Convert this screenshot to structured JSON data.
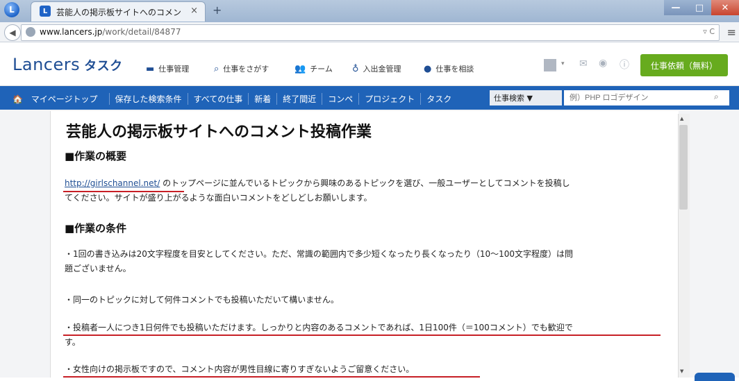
{
  "browser": {
    "app_letter": "L",
    "tab": {
      "favicon": "L",
      "title": "芸能人の掲示板サイトへのコメン...",
      "close": "×"
    },
    "newtab": "+",
    "window": {
      "min": "—",
      "max": "□",
      "close": "✕"
    },
    "url": {
      "host": "www.lancers.jp",
      "path": "/work/detail/84877"
    },
    "url_right": "▿ C"
  },
  "site": {
    "logo": "Lancers",
    "logo_task": "タスク",
    "nav": [
      {
        "label": "仕事管理",
        "icon": "laptop-icon"
      },
      {
        "label": "仕事をさがす",
        "icon": "search-icon"
      },
      {
        "label": "チーム",
        "icon": "team-icon"
      },
      {
        "label": "入出金管理",
        "icon": "money-icon"
      },
      {
        "label": "仕事を相談",
        "icon": "chat-icon"
      }
    ],
    "cta": "仕事依頼（無料）",
    "bluenav": [
      "マイページトップ",
      "保存した検索条件",
      "すべての仕事",
      "新着",
      "終了間近",
      "コンペ",
      "プロジェクト",
      "タスク"
    ],
    "search": {
      "select": "仕事検索 ▼",
      "placeholder": "例）PHP ロゴデザイン"
    }
  },
  "job": {
    "title": "芸能人の掲示板サイトへのコメント投稿作業",
    "overview_heading": "■作業の概要",
    "overview_link": "http://girlschannel.net/",
    "overview_text1": " のトップページに並んでいるトピックから興味のあるトピックを選び、一般ユーザーとしてコメントを投稿し",
    "overview_text2": "てください。サイトが盛り上がるような面白いコメントをどしどしお願いします。",
    "conditions_heading": "■作業の条件",
    "conditions": [
      {
        "line1": "・1回の書き込みは20文字程度を目安としてください。ただ、常識の範囲内で多少短くなったり長くなったり（10～100文字程度）は問",
        "line2": "題ございません。"
      },
      {
        "line1": "・同一のトピックに対して何件コメントでも投稿いただいて構いません。",
        "line2": ""
      },
      {
        "line1": "・投稿者一人につき1日何件でも投稿いただけます。しっかりと内容のあるコメントであれば、1日100件（＝100コメント）でも歓迎で",
        "line2": "す。"
      },
      {
        "line1": "・女性向けの掲示板ですので、コメント内容が男性目線に寄りすぎないようご留意ください。",
        "line2": ""
      }
    ]
  },
  "colors": {
    "brand": "#1f4e94",
    "bluenav": "#1f63b8",
    "cta": "#67ab1e",
    "underline": "#c71f25"
  }
}
